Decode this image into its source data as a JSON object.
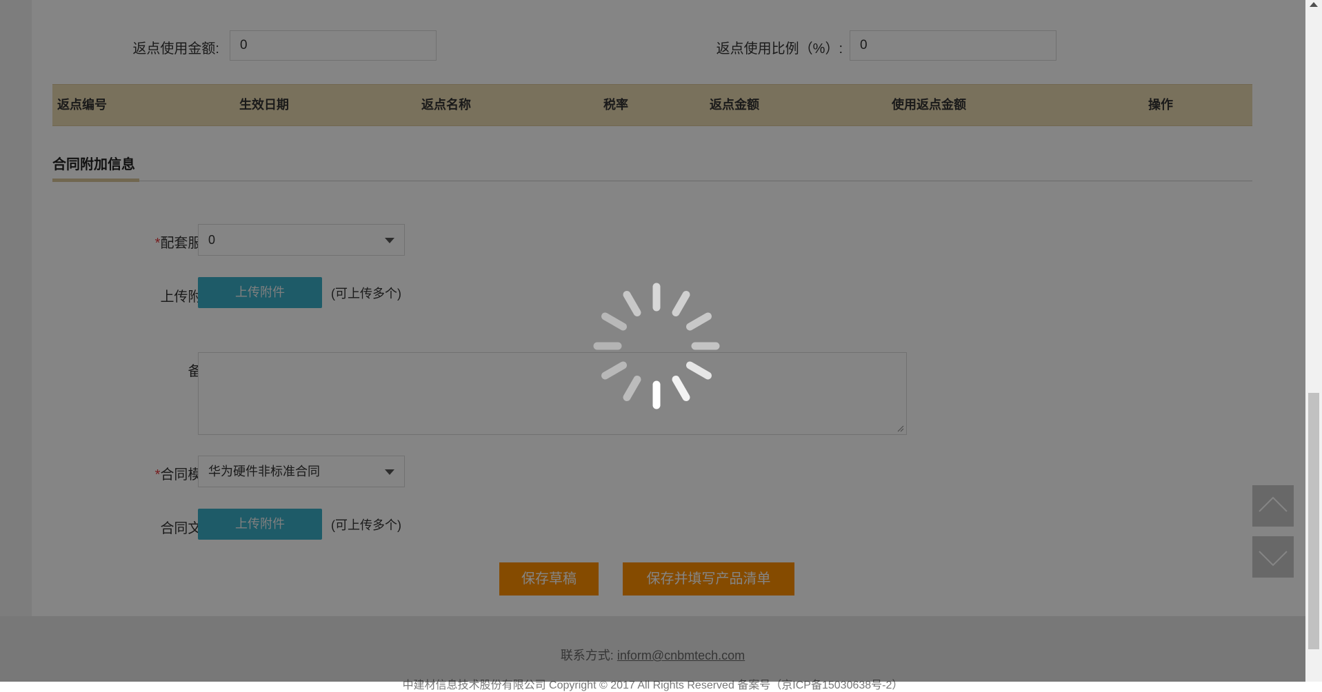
{
  "rebate": {
    "amount_label": "返点使用金额:",
    "amount_value": "0",
    "ratio_label": "返点使用比例（%）:",
    "ratio_value": "0"
  },
  "rebate_table": {
    "headers": [
      "返点编号",
      "生效日期",
      "返点名称",
      "税率",
      "返点金额",
      "使用返点金额",
      "操作"
    ]
  },
  "section": {
    "title": "合同附加信息"
  },
  "form": {
    "service": {
      "required_mark": "*",
      "label": "配套服务:",
      "value": "0"
    },
    "attachment": {
      "label": "上传附件:",
      "button": "上传附件",
      "hint": "(可上传多个)"
    },
    "remark": {
      "label": "备注:",
      "value": ""
    },
    "template": {
      "required_mark": "*",
      "label": "合同模版:",
      "value": "华为硬件非标准合同"
    },
    "contract_text": {
      "label": "合同文本:",
      "button": "上传附件",
      "hint": "(可上传多个)"
    }
  },
  "actions": {
    "save_draft": "保存草稿",
    "save_and_fill": "保存并填写产品清单"
  },
  "footer": {
    "contact_label": "联系方式:",
    "contact_email": "inform@cnbmtech.com",
    "copyright": "中建材信息技术股份有限公司 Copyright © 2017 All Rights Reserved 备案号（京ICP备15030638号-2）"
  },
  "colors": {
    "table_header_bg": "#e8d8b0",
    "upload_button": "#3aaec7",
    "action_button": "#ff9000",
    "required_mark": "#e4393c",
    "overlay": "rgba(0,0,0,0.48)"
  },
  "icons": {
    "scroll_top": "chevron-up-icon",
    "scroll_bottom": "chevron-down-icon",
    "loading": "loading-spinner-icon"
  }
}
